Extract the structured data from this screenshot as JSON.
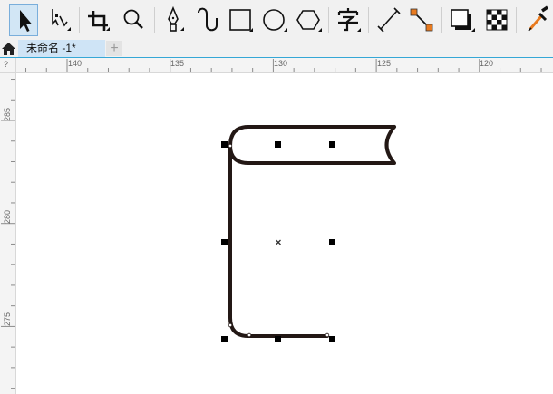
{
  "toolbar": {
    "tools": [
      {
        "name": "pick-tool-icon",
        "active": true
      },
      {
        "name": "shape-tool-icon"
      },
      {
        "name": "crop-tool-icon"
      },
      {
        "name": "zoom-tool-icon"
      },
      {
        "name": "pen-tool-icon"
      },
      {
        "name": "artistic-media-icon"
      },
      {
        "name": "rectangle-tool-icon"
      },
      {
        "name": "ellipse-tool-icon"
      },
      {
        "name": "polygon-tool-icon"
      },
      {
        "name": "text-tool-icon",
        "glyph": "字"
      },
      {
        "name": "dimension-tool-icon"
      },
      {
        "name": "connector-tool-icon"
      },
      {
        "name": "drop-shadow-tool-icon"
      },
      {
        "name": "transparency-tool-icon"
      },
      {
        "name": "eyedropper-tool-icon"
      }
    ]
  },
  "tabs": {
    "document_tab": "未命名 -1*",
    "add_tab": "+"
  },
  "rulers": {
    "corner": "?",
    "horizontal_ticks": [
      "140",
      "135",
      "130",
      "125",
      "120"
    ],
    "vertical_ticks": [
      "285",
      "280",
      "275"
    ]
  },
  "colors": {
    "stroke": "#231815",
    "accent": "#35a7d6",
    "active_tool": "#d2e6f5",
    "connector_node": "#e87a1f"
  }
}
